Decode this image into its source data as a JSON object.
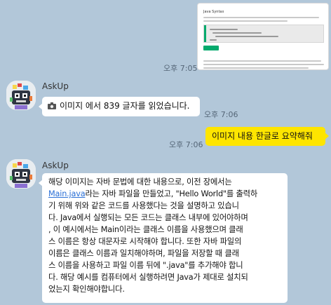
{
  "chat": {
    "shared_image": {
      "title": "Java Syntax"
    },
    "messages": [
      {
        "time": "오후 7:05"
      },
      {
        "sender": "AskUp",
        "icon": "camera-icon",
        "text": "이미지 에서 839 글자를 읽었습니다.",
        "time": "오후 7:06"
      },
      {
        "text": "이미지 내용 한글로 요약해줘",
        "time": "오후 7:06"
      },
      {
        "sender": "AskUp",
        "lines": [
          "해당 이미지는 자바 문법에 대한 내용으로, 이전 장에서는",
          "라는 자바 파일을 만들었고, \"Hello World\"를 출력하",
          "기 위해 위와 같은 코드를 사용했다는 것을 설명하고 있습니",
          "다. Java에서 실행되는 모든 코드는 클래스 내부에 있어야하며",
          ", 이 예시에서는 Main이라는 클래스 이름을 사용했으며 클래",
          "스 이름은 항상 대문자로 시작해야 합니다. 또한 자바 파일의",
          "이름은 클래스 이름과 일치해야하며, 파일을 저장할 때 클래",
          "스 이름을 사용하고 파일 이름 뒤에 \".java\"를 추가해야 합니",
          "다. 해당 예시를 컴퓨터에서 실행하려면 Java가 제대로 설치되",
          "었는지 확인해야합니다."
        ],
        "link_text": "Main.java"
      }
    ]
  },
  "colors": {
    "background": "#b2c7d9",
    "my_bubble": "#fee500",
    "bot_bubble": "#ffffff",
    "link": "#2a6fd6"
  }
}
